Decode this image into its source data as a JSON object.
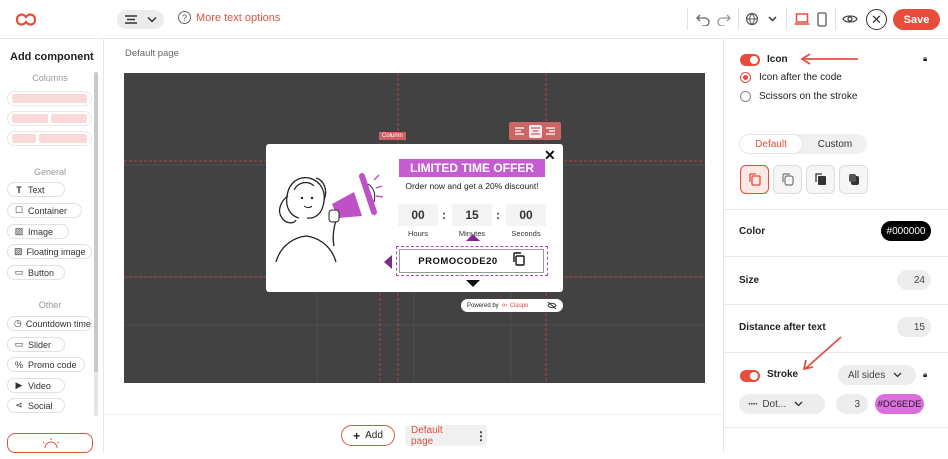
{
  "topbar": {
    "help_text": "More text options",
    "save_label": "Save"
  },
  "left_panel": {
    "title": "Add component",
    "sections": {
      "columns": "Columns",
      "general": "General",
      "other": "Other"
    },
    "general_items": [
      "Text",
      "Container",
      "Image",
      "Floating image",
      "Button"
    ],
    "other_items": [
      "Countdown timer",
      "Slider",
      "Promo code",
      "Video",
      "Social"
    ]
  },
  "canvas": {
    "page_label": "Default page",
    "column_tag": "Column",
    "popup": {
      "headline": "LIMITED TIME OFFER",
      "subline": "Order now and get a 20% discount!",
      "timer": [
        {
          "value": "00",
          "label": "Hours"
        },
        {
          "value": "15",
          "label": "Minutes"
        },
        {
          "value": "00",
          "label": "Seconds"
        }
      ],
      "separator": ":",
      "promo_code": "PROMOCODE20",
      "powered_by": "Powered by",
      "brand": "Claspo"
    }
  },
  "bottom_bar": {
    "add_label": "Add",
    "page_select": "Default page"
  },
  "right_panel": {
    "icon_label": "Icon",
    "radio_after": "Icon after the code",
    "radio_scissors": "Scissors on the stroke",
    "tab_default": "Default",
    "tab_custom": "Custom",
    "color_label": "Color",
    "color_value": "#000000",
    "size_label": "Size",
    "size_value": "24",
    "distance_label": "Distance after text",
    "distance_value": "15",
    "stroke_label": "Stroke",
    "stroke_sides": "All sides",
    "stroke_style": "Dot...",
    "stroke_width": "3",
    "stroke_color": "#DC6EDE"
  },
  "colors": {
    "accent": "#e74c3c",
    "purple": "#c050c8",
    "stroke_color": "#dc6ede"
  }
}
